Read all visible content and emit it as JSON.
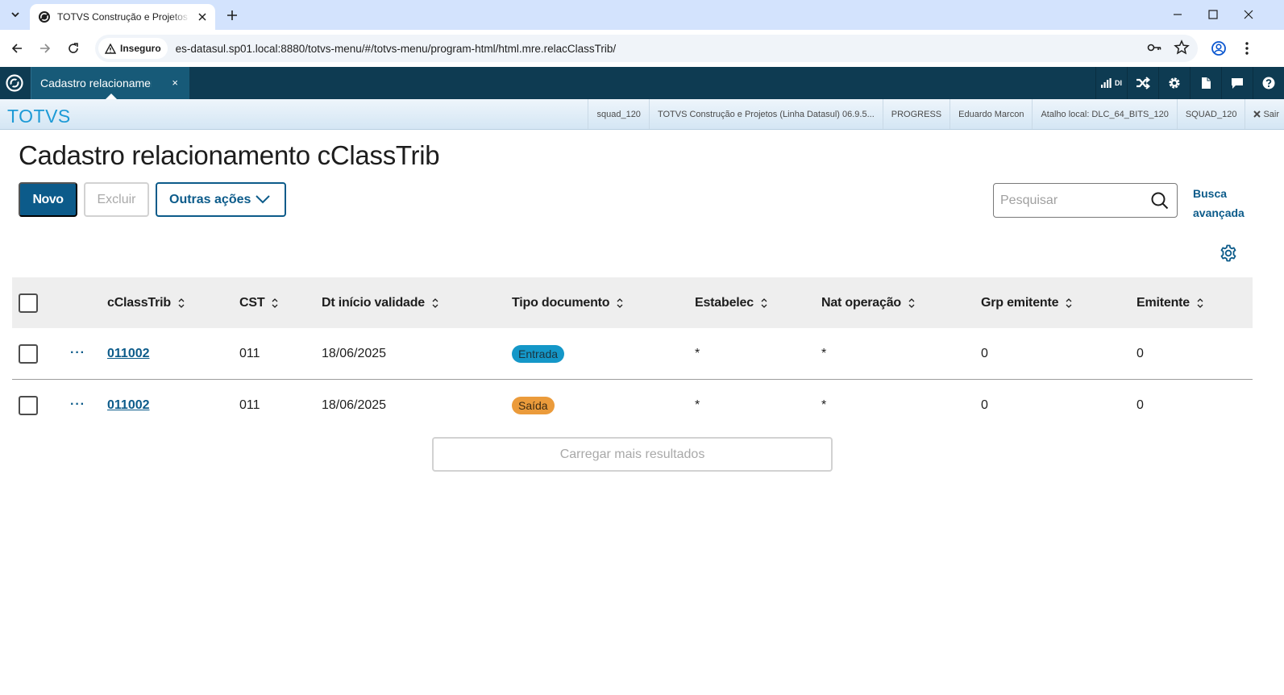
{
  "browser": {
    "tab_title": "TOTVS Construção e Projetos (Linha Datasul)",
    "insecure_label": "Inseguro",
    "url": "es-datasul.sp01.local:8880/totvs-menu/#/totvs-menu/program-html/html.mre.relacClassTrib/"
  },
  "app": {
    "active_tab_label": "Cadastro relacionamento cClassTrib",
    "tab_close": "×",
    "stats_label": "DI",
    "brand": "TOTVS",
    "info": {
      "squad": "squad_120",
      "product": "TOTVS Construção e Projetos (Linha Datasul) 06.9.5...",
      "database": "PROGRESS",
      "user": "Eduardo Marcon",
      "shortcut": "Atalho local: DLC_64_BITS_120",
      "env": "SQUAD_120",
      "logout": "Sair"
    }
  },
  "page": {
    "title": "Cadastro relacionamento cClassTrib",
    "new_label": "Novo",
    "delete_label": "Excluir",
    "other_actions_label": "Outras ações",
    "search_placeholder": "Pesquisar",
    "advanced_search_line1": "Busca",
    "advanced_search_line2": "avançada",
    "load_more_label": "Carregar mais resultados"
  },
  "table": {
    "headers": {
      "cclasstrib": "cClassTrib",
      "cst": "CST",
      "dt_inicio": "Dt início validade",
      "tipo_doc": "Tipo documento",
      "estabelec": "Estabelec",
      "nat_operacao": "Nat operação",
      "grp_emitente": "Grp emitente",
      "emitente": "Emitente"
    },
    "rows": [
      {
        "cclasstrib": "011002",
        "cst": "011",
        "dt_inicio": "18/06/2025",
        "tipo_doc": "Entrada",
        "estabelec": "*",
        "nat_operacao": "*",
        "grp_emitente": "0",
        "emitente": "0"
      },
      {
        "cclasstrib": "011002",
        "cst": "011",
        "dt_inicio": "18/06/2025",
        "tipo_doc": "Saída",
        "estabelec": "*",
        "nat_operacao": "*",
        "grp_emitente": "0",
        "emitente": "0"
      }
    ],
    "row_menu_glyph": "···"
  },
  "colors": {
    "primary": "#0c5b8a",
    "appbar": "#0e3b52",
    "brand": "#1d9ad6",
    "tag_entrada": "#1497c8",
    "tag_saida": "#eb9b3b"
  }
}
